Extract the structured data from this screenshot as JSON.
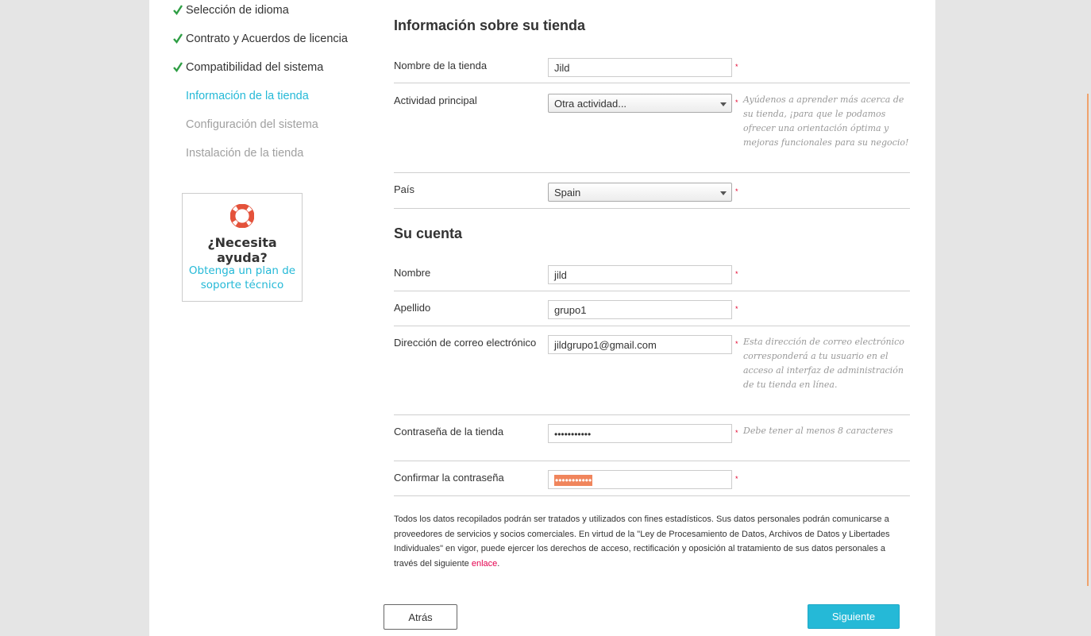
{
  "steps": [
    {
      "label": "Selección de idioma",
      "status": "done"
    },
    {
      "label": "Contrato y Acuerdos de licencia",
      "status": "done"
    },
    {
      "label": "Compatibilidad del sistema",
      "status": "done"
    },
    {
      "label": "Información de la tienda",
      "status": "current"
    },
    {
      "label": "Configuración del sistema",
      "status": "pending"
    },
    {
      "label": "Instalación de la tienda",
      "status": "pending"
    }
  ],
  "help": {
    "title": "¿Necesita ayuda?",
    "link_line1": "Obtenga un plan de",
    "link_line2": "soporte técnico",
    "icon": "lifebuoy-icon"
  },
  "store_section": {
    "title": "Información sobre su tienda",
    "store_name": {
      "label": "Nombre de la tienda",
      "value": "Jild"
    },
    "activity": {
      "label": "Actividad principal",
      "value": "Otra actividad...",
      "hint": "Ayúdenos a aprender más acerca de su tienda, ¡para que le podamos ofrecer una orientación óptima y mejoras funcionales para su negocio!"
    },
    "country": {
      "label": "País",
      "value": "Spain"
    }
  },
  "account_section": {
    "title": "Su cuenta",
    "first_name": {
      "label": "Nombre",
      "value": "jild"
    },
    "last_name": {
      "label": "Apellido",
      "value": "grupo1"
    },
    "email": {
      "label": "Dirección de correo electrónico",
      "value": "jildgrupo1@gmail.com",
      "hint": "Esta dirección de correo electrónico corresponderá a tu usuario en el acceso al interfaz de administración de tu tienda en línea."
    },
    "password": {
      "label": "Contraseña de la tienda",
      "value": "•••••••••••",
      "hint": "Debe tener al menos 8 caracteres"
    },
    "confirm_password": {
      "label": "Confirmar la contraseña",
      "value": "•••••••••••"
    }
  },
  "required_marker": "*",
  "privacy": {
    "text": "Todos los datos recopilados podrán ser tratados y utilizados con fines estadísticos. Sus datos personales podrán comunicarse a proveedores de servicios y socios comerciales. En virtud de la \"Ley de Procesamiento de Datos, Archivos de Datos y Libertades Individuales\" en vigor, puede ejercer los derechos de acceso, rectificación y oposición al tratamiento de sus datos personales a través del siguiente ",
    "link": "enlace",
    "end": "."
  },
  "buttons": {
    "back": "Atrás",
    "next": "Siguiente"
  },
  "colors": {
    "accent": "#25b9d7",
    "check": "#2e9e44",
    "required": "#e4002b",
    "selection": "#f0855c"
  }
}
